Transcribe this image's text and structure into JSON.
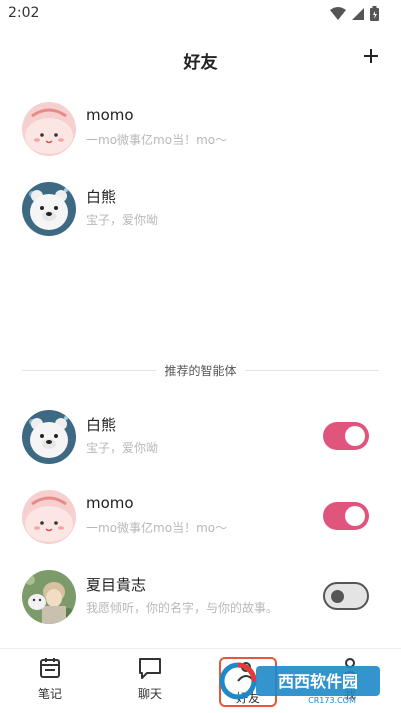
{
  "status": {
    "time": "2:02"
  },
  "header": {
    "title": "好友",
    "add_icon": "plus-icon"
  },
  "friends": [
    {
      "name": "momo",
      "desc": "一mo微事亿mo当！mo～",
      "avatar": "momo-pink-blob"
    },
    {
      "name": "白熊",
      "desc": "宝子，爱你呦",
      "avatar": "polar-bear"
    }
  ],
  "divider": {
    "label": "推荐的智能体"
  },
  "recommended": [
    {
      "name": "白熊",
      "desc": "宝子，爱你呦",
      "avatar": "polar-bear",
      "enabled": true
    },
    {
      "name": "momo",
      "desc": "一mo微事亿mo当！mo～",
      "avatar": "momo-pink-blob",
      "enabled": true
    },
    {
      "name": "夏目貴志",
      "desc": "我愿倾听，你的名字，与你的故事。",
      "avatar": "natsume",
      "enabled": false
    }
  ],
  "tabs": [
    {
      "label": "笔记",
      "icon": "calendar-icon"
    },
    {
      "label": "聊天",
      "icon": "chat-bubble-icon"
    },
    {
      "label": "好友",
      "icon": "friends-icon"
    },
    {
      "label": "我",
      "icon": "person-icon"
    }
  ],
  "watermark": {
    "text": "西西软件园",
    "sub": "CR173.COM"
  },
  "colors": {
    "accent": "#e0557e",
    "toggle_off": "#e4e4e4"
  }
}
